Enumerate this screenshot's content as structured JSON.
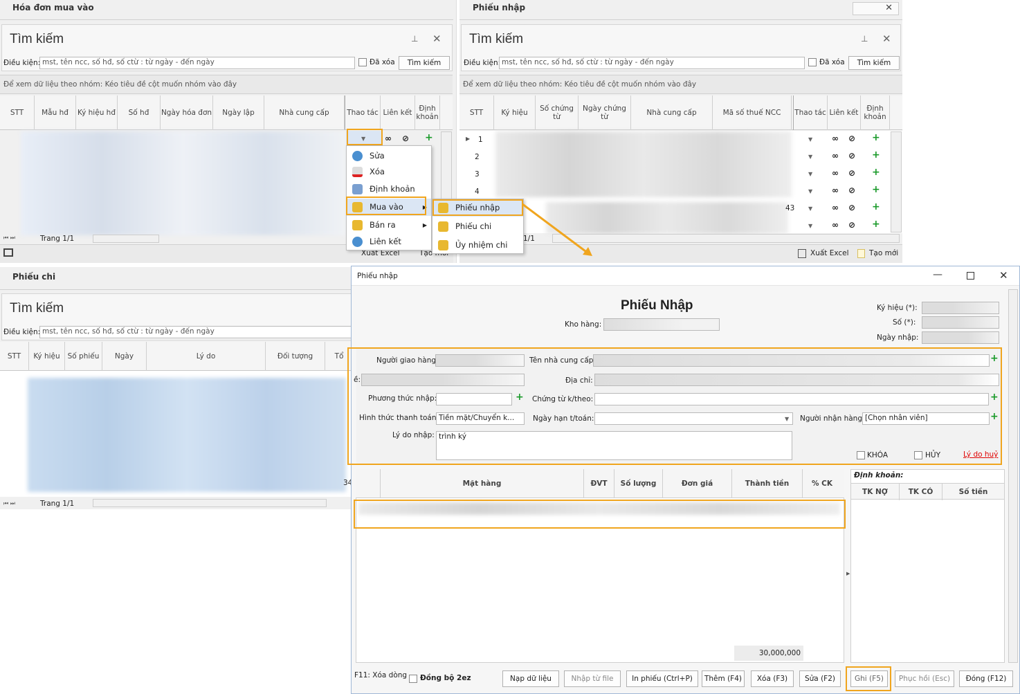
{
  "panel_hoadon": {
    "title": "Hóa đơn mua vào",
    "search_title": "Tìm kiếm",
    "condition_label": "Điều kiện:",
    "condition_value": "mst, tên ncc, số hđ, số ctừ : từ ngày - đến ngày",
    "deleted_label": "Đã xóa",
    "search_button": "Tìm kiếm",
    "group_hint": "Để xem dữ liệu theo nhóm: Kéo tiêu đề cột muốn nhóm vào đây",
    "columns": [
      "STT",
      "Mẫu hđ",
      "Ký hiệu hđ",
      "Số hđ",
      "Ngày hóa đơn",
      "Ngày lập",
      "Nhà cung cấp",
      "Thao tác",
      "Liên kết",
      "Định khoản"
    ],
    "pager": "Trang 1/1",
    "export_label": "Xuất Excel",
    "new_label": "Tạo mới"
  },
  "context_menu": {
    "items": [
      "Sửa",
      "Xóa",
      "Định khoản",
      "Mua vào",
      "Bán ra",
      "Liên kết"
    ],
    "submenu": [
      "Phiếu nhập",
      "Phiếu chi",
      "Ủy nhiệm chi"
    ]
  },
  "panel_phieunhap": {
    "title": "Phiếu nhập",
    "search_title": "Tìm kiếm",
    "condition_label": "Điều kiện:",
    "condition_value": "mst, tên ncc, số hđ, số ctừ : từ ngày - đến ngày",
    "deleted_label": "Đã xóa",
    "search_button": "Tìm kiếm",
    "group_hint": "Để xem dữ liệu theo nhóm: Kéo tiêu đề cột muốn nhóm vào đây",
    "columns": [
      "STT",
      "Ký hiệu",
      "Số chứng từ",
      "Ngày chứng từ",
      "Nhà cung cấp",
      "Mã số thuế NCC",
      "Thao tác",
      "Liên kết",
      "Định khoản"
    ],
    "rows": [
      "1",
      "2",
      "3",
      "4"
    ],
    "partial_value": "43",
    "pager": "1/1",
    "export_label": "Xuất Excel",
    "new_label": "Tạo mới"
  },
  "panel_phieuchi": {
    "title": "Phiếu chi",
    "search_title": "Tìm kiếm",
    "condition_label": "Điều kiện:",
    "condition_value": "mst, tên ncc, số hđ, số ctừ : từ ngày - đến ngày",
    "columns": [
      "STT",
      "Ký hiệu",
      "Số phiếu",
      "Ngày",
      "Lý do",
      "Đối tượng",
      "Tổ"
    ],
    "partial_value": "34",
    "pager": "Trang 1/1"
  },
  "dialog": {
    "window_title": "Phiếu nhập",
    "heading": "Phiếu Nhập",
    "kho_hang_label": "Kho hàng:",
    "ky_hieu_label": "Ký hiệu (*):",
    "so_label": "Số (*):",
    "ngay_nhap_label": "Ngày nhập:",
    "nguoi_giao_label": "Người giao hàng:",
    "ten_ncc_label": "Tên nhà cung cấp:",
    "partial_label": "ề:",
    "dia_chi_label": "Địa chỉ:",
    "phuong_thuc_label": "Phương thức nhập:",
    "chung_tu_label": "Chứng từ k/theo:",
    "hinh_thuc_label": "Hình thức thanh toán:",
    "hinh_thuc_value": "Tiền mặt/Chuyển k...",
    "ngay_han_label": "Ngày hạn t/toán:",
    "nguoi_nhan_label": "Người nhận hàng:",
    "nguoi_nhan_value": "[Chọn nhân viên]",
    "ly_do_label": "Lý do nhập:",
    "ly_do_value": "trình ký",
    "khoa_label": "KHÓA",
    "huy_label": "HỦY",
    "ly_do_huy": "Lý do huỷ",
    "item_columns": [
      "Mặt hàng",
      "ĐVT",
      "Số lượng",
      "Đơn giá",
      "Thành tiền",
      "% CK"
    ],
    "total": "30,000,000",
    "dinh_khoan_title": "Định khoản:",
    "dk_columns": [
      "TK NỢ",
      "TK CÓ",
      "Số tiền"
    ],
    "f11_hint": "F11: Xóa dòng",
    "sync_label": "Đồng bộ 2ez",
    "buttons": [
      "Nạp dữ liệu",
      "Nhập từ file",
      "In phiếu   (Ctrl+P)",
      "Thêm   (F4)",
      "Xóa   (F3)",
      "Sửa   (F2)",
      "Ghi   (F5)",
      "Phục hồi   (Esc)",
      "Đóng   (F12)"
    ]
  },
  "colors": {
    "highlight": "#f0a51e",
    "plus": "#1a9a2a",
    "link_red": "#e00000"
  }
}
